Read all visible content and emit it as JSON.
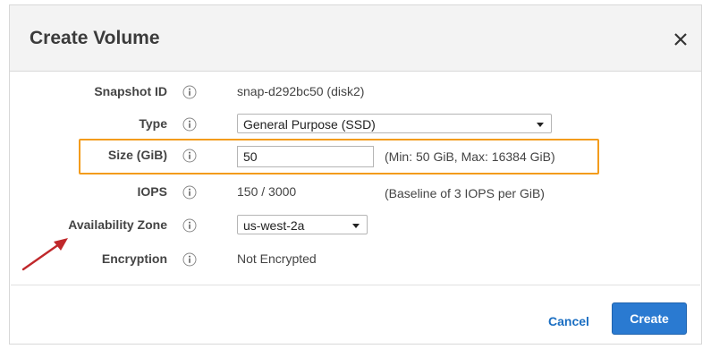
{
  "dialog": {
    "title": "Create Volume",
    "close_label": "×"
  },
  "fields": {
    "snapshot": {
      "label": "Snapshot ID",
      "value": "snap-d292bc50 (disk2)"
    },
    "type": {
      "label": "Type",
      "selected": "General Purpose (SSD)"
    },
    "size": {
      "label": "Size (GiB)",
      "value": "50",
      "hint": "(Min: 50 GiB, Max: 16384 GiB)"
    },
    "iops": {
      "label": "IOPS",
      "value": "150 / 3000",
      "hint": "(Baseline of 3 IOPS per GiB)"
    },
    "az": {
      "label": "Availability Zone",
      "selected": "us-west-2a"
    },
    "encryption": {
      "label": "Encryption",
      "value": "Not Encrypted"
    }
  },
  "footer": {
    "cancel_label": "Cancel",
    "create_label": "Create"
  },
  "icons": {
    "info": "info-icon",
    "close": "close-icon",
    "annotation": "red-arrow-annotation"
  },
  "colors": {
    "highlight": "#f39c1c",
    "primary": "#2a7ad1",
    "link": "#1a6ec2",
    "arrow": "#c0282b"
  }
}
